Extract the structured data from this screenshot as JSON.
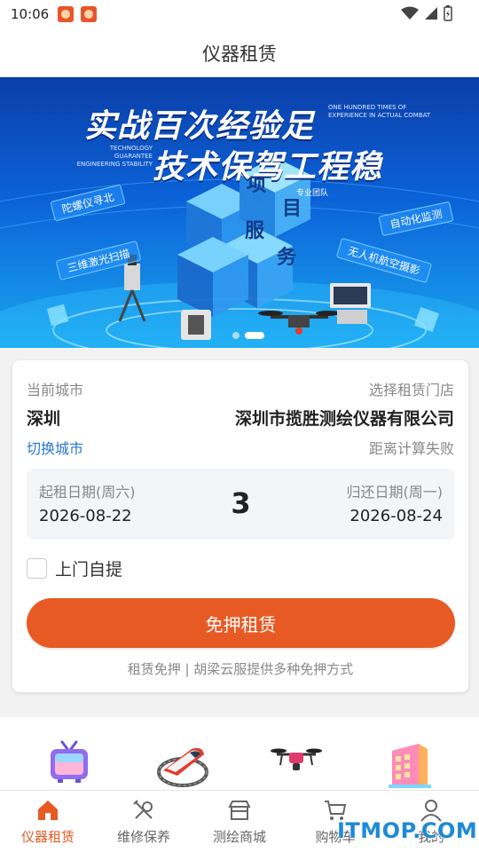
{
  "status_bar": {
    "time": "10:06",
    "icons": [
      "notification-app-icon",
      "notification-app-icon",
      "wifi-icon",
      "signal-icon",
      "battery-icon"
    ]
  },
  "header": {
    "title": "仪器租赁"
  },
  "banner": {
    "headline_line1": "实战百次经验足",
    "headline_line2": "技术保驾工程稳",
    "en_right": "ONE HUNDRED TIMES OF EXPERIENCE IN ACTUAL COMBAT",
    "en_left": "TECHNOLOGY GUARANTEE ENGINEERING STABILITY",
    "cube_text": [
      "项",
      "目",
      "服",
      "务"
    ],
    "tags": {
      "team": "专业团队",
      "gyro": "陀螺仪寻北",
      "laser": "三维激光扫描",
      "monitor": "自动化监测",
      "uav": "无人机航空摄影"
    },
    "active_slide": 2,
    "slide_count": 2
  },
  "rental": {
    "current_city_label": "当前城市",
    "select_store_label": "选择租赁门店",
    "city": "深圳",
    "store": "深圳市揽胜测绘仪器有限公司",
    "switch_city": "切换城市",
    "distance_status": "距离计算失败",
    "start_date_label": "起租日期(周六)",
    "start_date": "2026-08-22",
    "end_date_label": "归还日期(周一)",
    "end_date": "2026-08-24",
    "days": "3",
    "pickup_label": "上门自提",
    "pickup_checked": false,
    "rent_button": "免押租赁",
    "note": "租赁免押 | 胡梁云服提供多种免押方式"
  },
  "categories": {
    "icons": [
      "tv-icon",
      "train-icon",
      "drone-icon",
      "building-icon"
    ]
  },
  "bottom_nav": {
    "items": [
      {
        "label": "仪器租赁",
        "icon": "home-icon",
        "active": true
      },
      {
        "label": "维修保养",
        "icon": "tools-icon",
        "active": false
      },
      {
        "label": "测绘商城",
        "icon": "store-icon",
        "active": false
      },
      {
        "label": "购物车",
        "icon": "cart-icon",
        "active": false
      },
      {
        "label": "我的",
        "icon": "user-icon",
        "active": false
      }
    ]
  },
  "watermark": "ITMOP.COM",
  "colors": {
    "accent": "#e85a24",
    "link": "#2a74d6",
    "banner_top": "#0b3ea8",
    "banner_bottom": "#1aa6f0"
  }
}
